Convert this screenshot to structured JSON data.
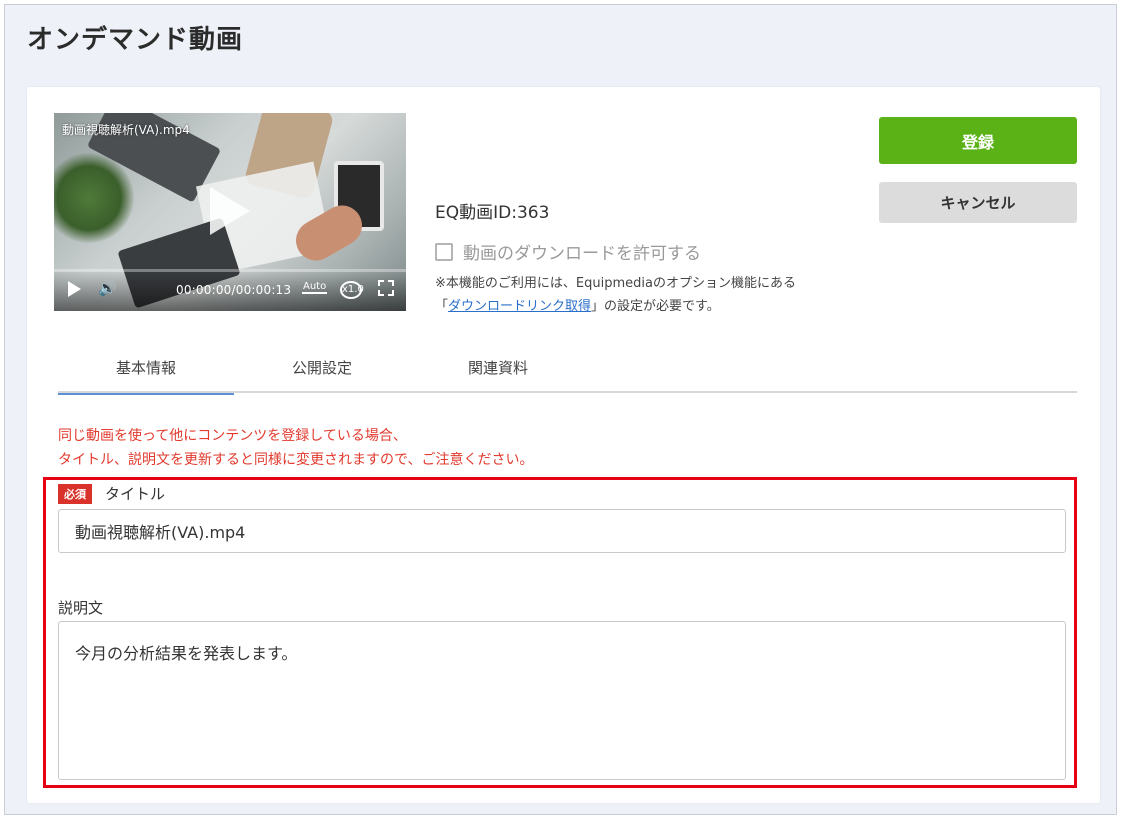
{
  "page": {
    "title": "オンデマンド動画"
  },
  "video": {
    "title": "動画視聴解析(VA).mp4",
    "time": "00:00:00/00:00:13",
    "quality": "Auto",
    "speed": "x1.0"
  },
  "info": {
    "video_id": "EQ動画ID:363",
    "download_label": "動画のダウンロードを許可する",
    "download_checked": false,
    "note_line1": "※本機能のご利用には、Equipmediaのオプション機能にある",
    "note_open": "「",
    "note_link": "ダウンロードリンク取得",
    "note_close": "」の設定が必要です。"
  },
  "actions": {
    "register": "登録",
    "cancel": "キャンセル"
  },
  "tabs": [
    {
      "label": "基本情報",
      "active": true
    },
    {
      "label": "公開設定",
      "active": false
    },
    {
      "label": "関連資料",
      "active": false
    }
  ],
  "warning": {
    "line1": "同じ動画を使って他にコンテンツを登録している場合、",
    "line2": "タイトル、説明文を更新すると同様に変更されますので、ご注意ください。"
  },
  "form": {
    "required_badge": "必須",
    "title_label": "タイトル",
    "title_value": "動画視聴解析(VA).mp4",
    "description_label": "説明文",
    "description_value": "今月の分析結果を発表します。"
  },
  "colors": {
    "accent_green": "#5ab216",
    "warning_red": "#e23a2e",
    "highlight_red": "#e60012",
    "tab_active": "#5b8fd8",
    "link_blue": "#2a6fc9"
  }
}
